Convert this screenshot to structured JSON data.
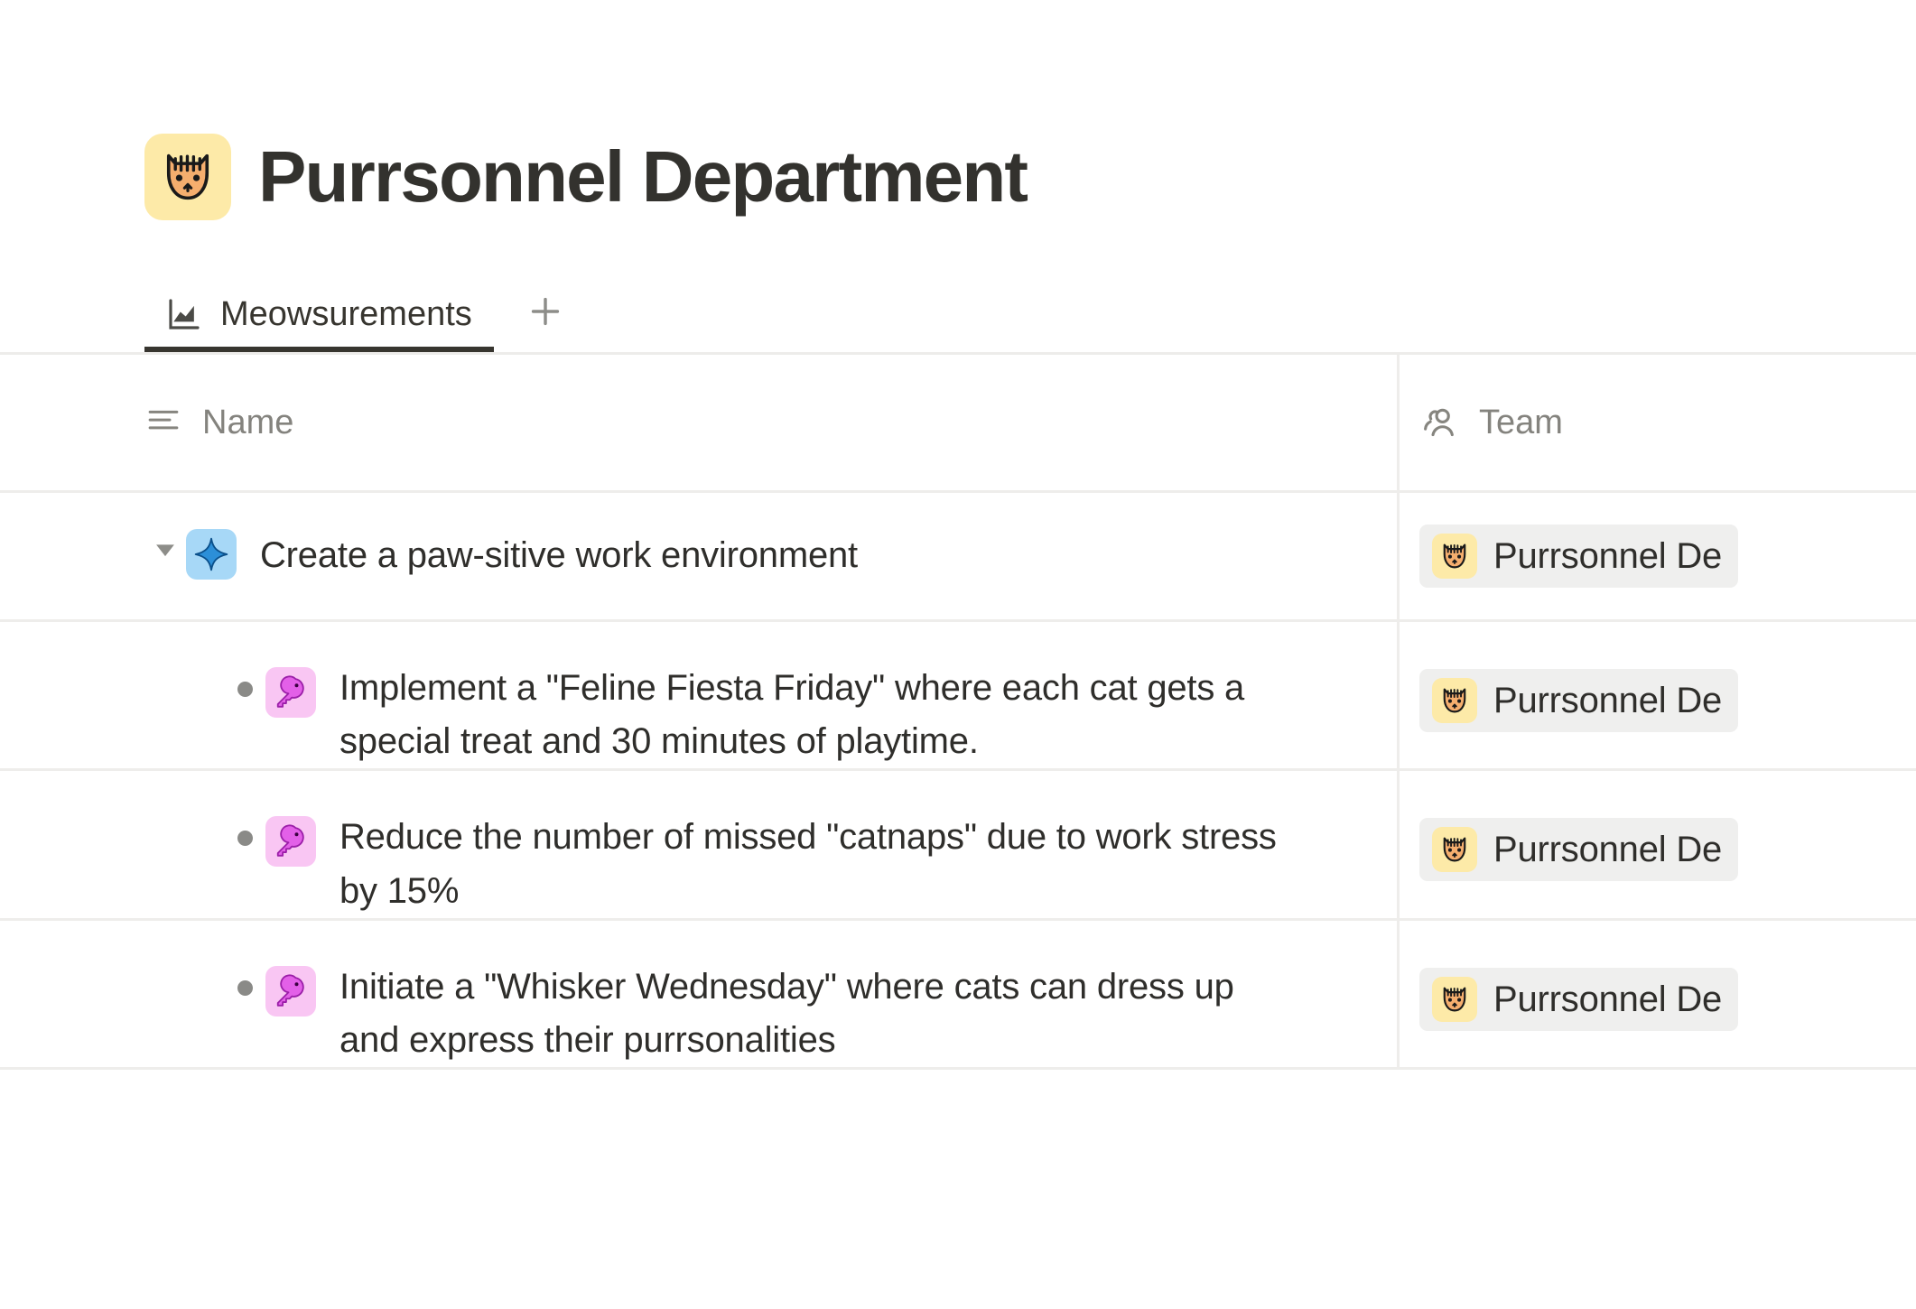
{
  "page": {
    "emoji_name": "cat-face-emoji",
    "title": "Purrsonnel Department"
  },
  "tabs": {
    "items": [
      {
        "label": "Meowsurements",
        "icon": "chart-icon",
        "active": true
      }
    ],
    "add_tab_label": "+"
  },
  "table": {
    "columns": [
      {
        "key": "name",
        "label": "Name",
        "icon": "text-lines-icon"
      },
      {
        "key": "team",
        "label": "Team",
        "icon": "people-icon"
      }
    ],
    "rows": [
      {
        "type": "parent",
        "expanded": true,
        "toggle": "▼",
        "icon": "sparkle-star-icon",
        "icon_color": "#1a7fd4",
        "icon_bg": "#a7d8f7",
        "name": "Create a paw-sitive work environment",
        "team": "Purrsonnel De",
        "team_emoji": "cat-face-emoji"
      },
      {
        "type": "child",
        "bullet": "•",
        "icon": "key-icon",
        "icon_color": "#d94ae0",
        "icon_bg": "#f9c6f3",
        "name": "Implement a \"Feline Fiesta Friday\" where each cat gets a special treat and 30 minutes of playtime.",
        "team": "Purrsonnel De",
        "team_emoji": "cat-face-emoji"
      },
      {
        "type": "child",
        "bullet": "•",
        "icon": "key-icon",
        "icon_color": "#d94ae0",
        "icon_bg": "#f9c6f3",
        "name": "Reduce the number of missed \"catnaps\" due to work stress by 15%",
        "team": "Purrsonnel De",
        "team_emoji": "cat-face-emoji"
      },
      {
        "type": "child",
        "bullet": "•",
        "icon": "key-icon",
        "icon_color": "#d94ae0",
        "icon_bg": "#f9c6f3",
        "name": "Initiate a \"Whisker Wednesday\" where cats can dress up and express their purrsonalities",
        "team": "Purrsonnel De",
        "team_emoji": "cat-face-emoji"
      }
    ]
  },
  "colors": {
    "text": "#37352f",
    "muted": "#84837e",
    "divider": "#eeedeb",
    "emoji_bg": "#fdeaa8",
    "chip_bg": "#efefee",
    "star_bg": "#a7d8f7",
    "key_bg": "#f9c6f3"
  }
}
